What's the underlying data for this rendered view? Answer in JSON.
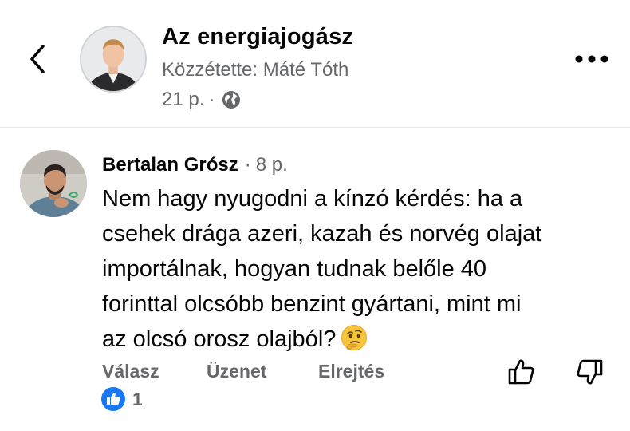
{
  "header": {
    "page_name": "Az energiajogász",
    "posted_by": "Közzétette: Máté Tóth",
    "time": "21 p.",
    "separator": "·",
    "icons": {
      "back": "chevron-left-icon",
      "audience": "globe-icon",
      "more": "more-horizontal-icon"
    }
  },
  "comment": {
    "author": "Bertalan Grósz",
    "separator": "·",
    "time": "8 p.",
    "lines": [
      "Nem hagy nyugodni a kínzó kérdés: ha a",
      "csehek drága azeri, kazah és norvég olajat",
      "importálnak, hogyan tudnak belőle 40",
      "forinttal olcsóbb benzint gyártani, mint mi",
      "az olcsó orosz olajból?"
    ],
    "emoji": "thinking-face-emoji"
  },
  "actions": {
    "reply": "Válasz",
    "message": "Üzenet",
    "hide": "Elrejtés",
    "icons": {
      "like": "thumbs-up-icon",
      "dislike": "thumbs-down-icon"
    }
  },
  "reactions": {
    "icon": "like-reaction-icon",
    "count": "1",
    "color": "#1877f2"
  },
  "colors": {
    "text": "#050505",
    "secondary_text": "#65676b",
    "divider": "#e4e6eb",
    "like_blue": "#1877f2"
  }
}
